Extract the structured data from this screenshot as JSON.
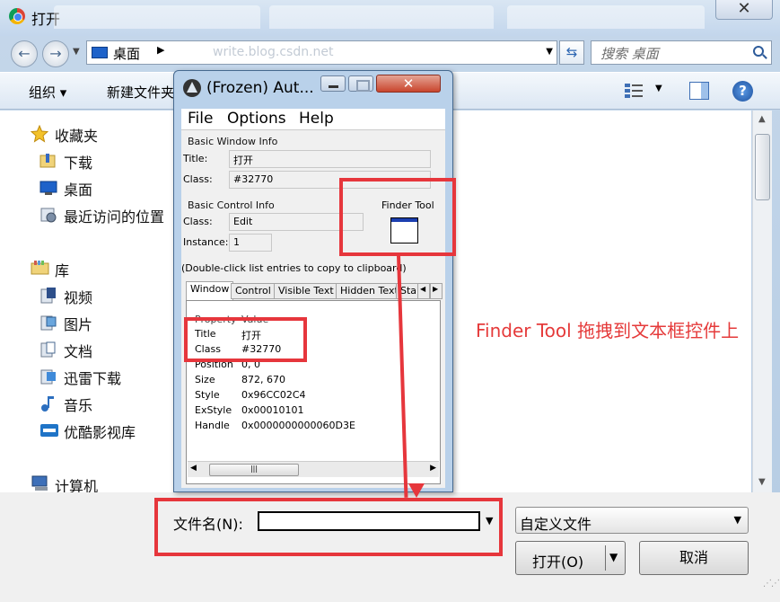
{
  "window": {
    "title": "打开",
    "close_glyph": "✕"
  },
  "address": {
    "location": "桌面",
    "ghost_text": "write.blog.csdn.net",
    "search_placeholder": "搜索 桌面"
  },
  "toolbar": {
    "organize": "组织 ▾",
    "new_folder": "新建文件夹"
  },
  "nav": {
    "favorites": "收藏夹",
    "downloads": "下载",
    "desktop": "桌面",
    "recent": "最近访问的位置",
    "libraries": "库",
    "videos": "视频",
    "pictures": "图片",
    "documents": "文档",
    "xunlei": "迅雷下载",
    "music": "音乐",
    "youku": "优酷影视库",
    "computer": "计算机"
  },
  "annotation": "Finder Tool 拖拽到文本框控件上",
  "bottom": {
    "filename_label": "文件名(N):",
    "filename_value": "",
    "filetype": "自定义文件",
    "open_button": "打开(O)",
    "cancel_button": "取消"
  },
  "au3info": {
    "title": "(Frozen) Aut...",
    "menu": {
      "file": "File",
      "options": "Options",
      "help": "Help"
    },
    "basic_window": {
      "group": "Basic Window Info",
      "title_label": "Title:",
      "title_value": "打开",
      "class_label": "Class:",
      "class_value": "#32770"
    },
    "basic_control": {
      "group": "Basic Control Info",
      "class_label": "Class:",
      "class_value": "Edit",
      "instance_label": "Instance:",
      "instance_value": "1"
    },
    "finder_tool": "Finder Tool",
    "hint": "(Double-click list entries to copy to clipboard)",
    "tabs": [
      "Window",
      "Control",
      "Visible Text",
      "Hidden Text",
      "Sta"
    ],
    "list_headers": {
      "property": "Property",
      "value": "Value"
    },
    "rows": [
      {
        "property": "Title",
        "value": "打开"
      },
      {
        "property": "Class",
        "value": "#32770"
      },
      {
        "property": "Position",
        "value": "0, 0"
      },
      {
        "property": "Size",
        "value": "872, 670"
      },
      {
        "property": "Style",
        "value": "0x96CC02C4"
      },
      {
        "property": "ExStyle",
        "value": "0x00010101"
      },
      {
        "property": "Handle",
        "value": "0x0000000000060D3E"
      }
    ]
  }
}
